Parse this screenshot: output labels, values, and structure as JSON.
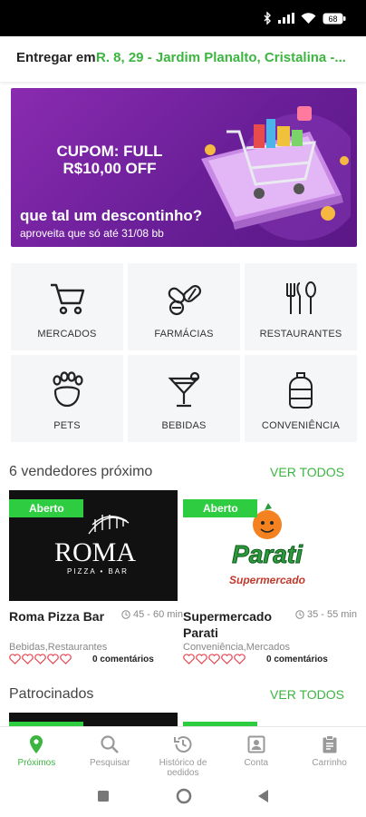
{
  "delivery": {
    "label": "Entregar em:",
    "address": "R. 8, 29 - Jardim Planalto, Cristalina -..."
  },
  "banner": {
    "coupon": "CUPOM: FULL",
    "discount": "R$10,00 OFF",
    "headline": "que tal um descontinho?",
    "subline": "aproveita que só até 31/08 bb"
  },
  "categories": [
    {
      "label": "MERCADOS",
      "icon": "shopping-cart-icon"
    },
    {
      "label": "FARMÁCIAS",
      "icon": "pills-icon"
    },
    {
      "label": "RESTAURANTES",
      "icon": "cutlery-icon"
    },
    {
      "label": "PETS",
      "icon": "paw-icon"
    },
    {
      "label": "BEBIDAS",
      "icon": "cocktail-icon"
    },
    {
      "label": "CONVENIÊNCIA",
      "icon": "water-jug-icon"
    }
  ],
  "nearby": {
    "title": "6 vendedores próximo",
    "see_all": "VER TODOS",
    "stores": [
      {
        "badge": "Aberto",
        "name": "Roma Pizza Bar",
        "time": "45 - 60 min",
        "tags": "Bebidas,Restaurantes",
        "comments": "0 comentários",
        "logo_text": "ROMA",
        "logo_sub": "PIZZA • BAR"
      },
      {
        "badge": "Aberto",
        "name": "Supermercado Parati",
        "time": "35 - 55 min",
        "tags": "Conveniência,Mercados",
        "comments": "0 comentários",
        "logo_text": "Parati",
        "logo_sub": "Supermercado"
      }
    ]
  },
  "sponsored": {
    "title": "Patrocinados",
    "see_all": "VER TODOS"
  },
  "nav": [
    {
      "label": "Próximos",
      "icon": "location-pin-icon",
      "active": true
    },
    {
      "label": "Pesquisar",
      "icon": "search-icon",
      "active": false
    },
    {
      "label": "Histórico de pedidos",
      "icon": "history-icon",
      "active": false
    },
    {
      "label": "Conta",
      "icon": "account-icon",
      "active": false
    },
    {
      "label": "Carrinho",
      "icon": "clipboard-icon",
      "active": false
    }
  ],
  "battery": "68",
  "colors": {
    "accent": "#3cb540",
    "badge": "#2ecc40",
    "banner": "#7a24a6",
    "heart": "#e8424d"
  }
}
